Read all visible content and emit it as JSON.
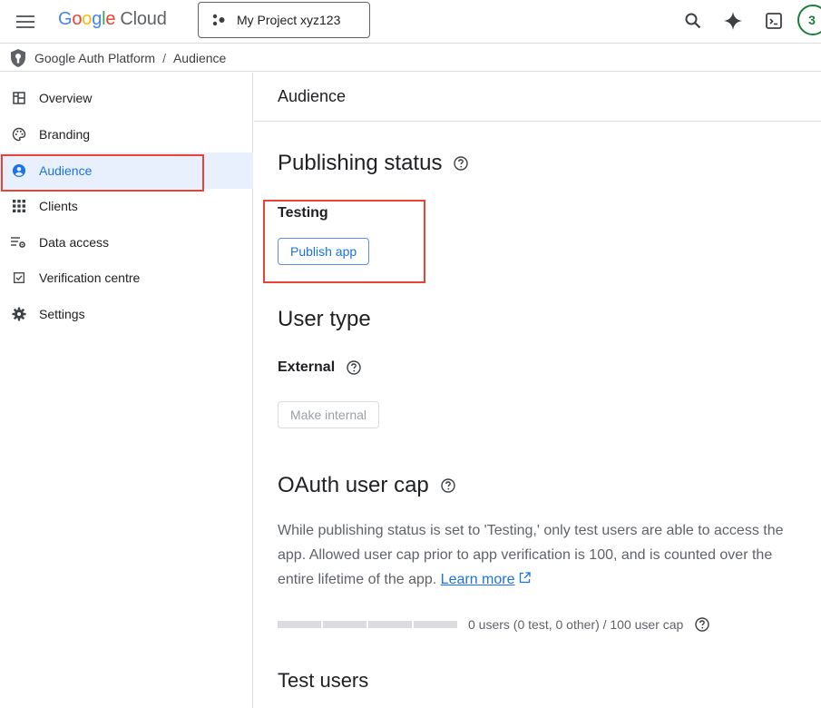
{
  "header": {
    "logo_google": "Google",
    "logo_cloud": "Cloud",
    "project": "My Project xyz123",
    "avatar_initial": "3",
    "icons": [
      "menu-icon",
      "search-icon",
      "gemini-sparkle-icon",
      "cloud-shell-icon"
    ]
  },
  "breadcrumb": {
    "items": [
      "Google Auth Platform",
      "Audience"
    ],
    "separator": "/"
  },
  "sidebar": {
    "items": [
      {
        "label": "Overview",
        "icon": "dashboard-icon"
      },
      {
        "label": "Branding",
        "icon": "palette-icon"
      },
      {
        "label": "Audience",
        "icon": "account-circle-icon",
        "active": true
      },
      {
        "label": "Clients",
        "icon": "apps-grid-icon"
      },
      {
        "label": "Data access",
        "icon": "data-settings-icon"
      },
      {
        "label": "Verification centre",
        "icon": "checkbox-icon"
      },
      {
        "label": "Settings",
        "icon": "gear-icon"
      }
    ]
  },
  "main": {
    "page_title": "Audience",
    "publishing": {
      "title": "Publishing status",
      "status": "Testing",
      "button": "Publish app"
    },
    "user_type": {
      "title": "User type",
      "value": "External",
      "button": "Make internal"
    },
    "oauth_cap": {
      "title": "OAuth user cap",
      "description": "While publishing status is set to 'Testing,' only test users are able to access the app. Allowed user cap prior to app verification is 100, and is counted over the entire lifetime of the app.",
      "learn_more": "Learn more",
      "usage_text": "0 users (0 test, 0 other) / 100 user cap",
      "usage_fraction": 0
    },
    "test_users": {
      "title": "Test users"
    }
  },
  "colors": {
    "accent": "#1a73e8",
    "active_bg": "#e8f0fe",
    "highlight": "#ea4335"
  }
}
